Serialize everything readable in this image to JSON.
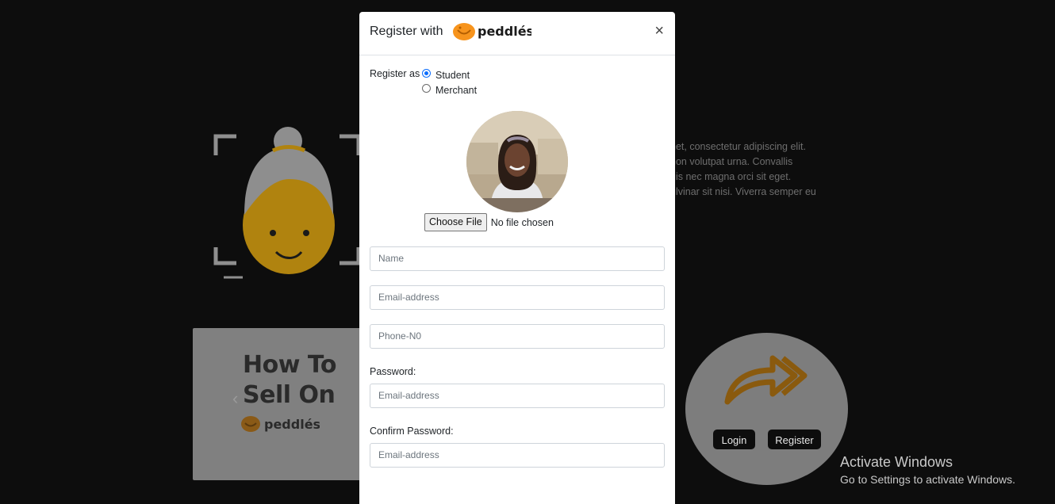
{
  "background": {
    "paragraph_lines": [
      "net, consectetur adipiscing elit.",
      "non volutpat urna. Convallis",
      "uis nec magna orci sit eget.",
      "ulvinar sit nisi. Viverra semper eu"
    ],
    "sell_card": {
      "line1": "How To",
      "line2": "Sell On",
      "logo_text": "peddlés"
    },
    "circle_card": {
      "login_label": "Login",
      "register_label": "Register"
    },
    "watermark": {
      "title": "Activate Windows",
      "subtitle": "Go to Settings to activate Windows."
    }
  },
  "modal": {
    "title": "Register with",
    "logo_text": "peddlés",
    "close_label": "×",
    "register_as_label": "Register as :",
    "roles": [
      {
        "label": "Student",
        "checked": true
      },
      {
        "label": "Merchant",
        "checked": false
      }
    ],
    "file": {
      "button_label": "Choose File",
      "status": "No file chosen"
    },
    "fields": {
      "name_placeholder": "Name",
      "email_placeholder": "Email-address",
      "phone_placeholder": "Phone-N0",
      "password_label": "Password:",
      "password_placeholder": "Email-address",
      "confirm_label": "Confirm Password:",
      "confirm_placeholder": "Email-address"
    }
  },
  "colors": {
    "brand_orange": "#f7941d",
    "radio_blue": "#0d6efd",
    "backdrop": "#0d0d0d"
  }
}
